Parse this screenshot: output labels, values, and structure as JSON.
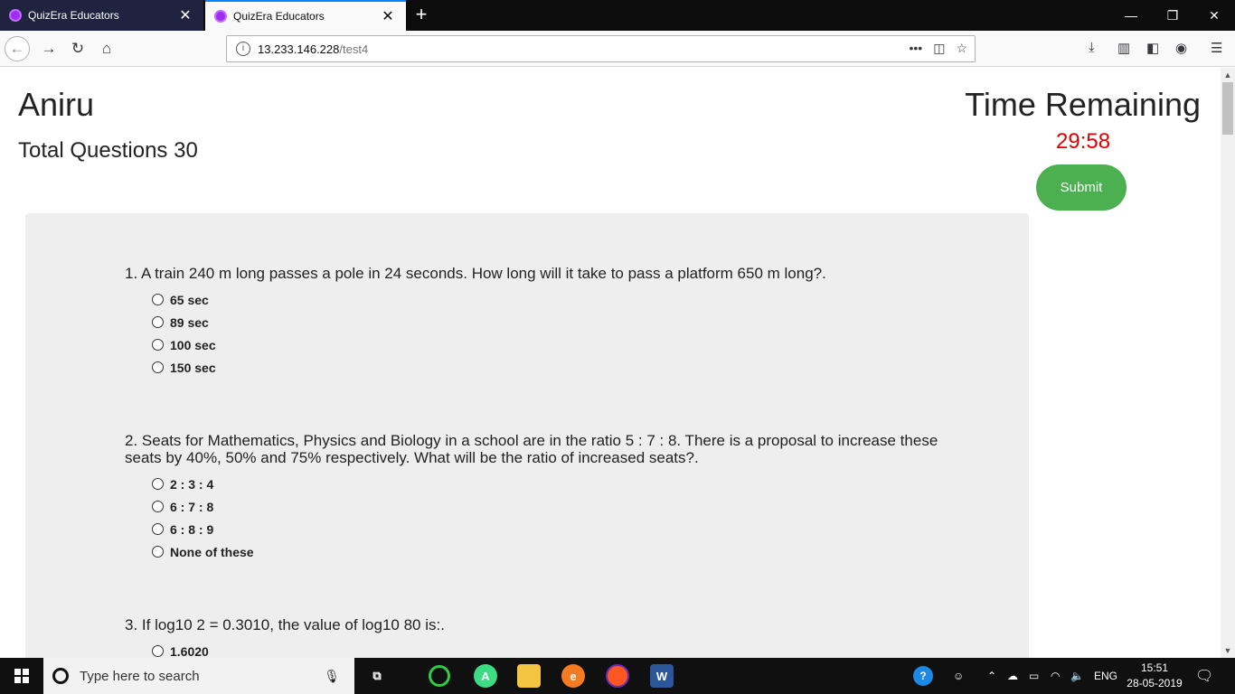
{
  "browser": {
    "tabs": [
      {
        "title": "QuizEra Educators",
        "active": false
      },
      {
        "title": "QuizEra Educators",
        "active": true
      }
    ],
    "url_host": "13.233.146.228",
    "url_path": "/test4"
  },
  "header": {
    "user_name": "Aniru",
    "total_questions": "Total Questions 30",
    "time_label": "Time Remaining",
    "timer": "29:58",
    "submit_label": "Submit"
  },
  "questions": [
    {
      "text": "1. A train 240 m long passes a pole in 24 seconds. How long will it take to pass a platform 650 m long?.",
      "options": [
        "65 sec",
        "89 sec",
        "100 sec",
        "150 sec"
      ]
    },
    {
      "text": "2. Seats for Mathematics, Physics and Biology in a school are in the ratio 5 : 7 : 8. There is a proposal to increase these seats by 40%, 50% and 75% respectively. What will be the ratio of increased seats?.",
      "options": [
        "2 : 3 : 4",
        "6 : 7 : 8",
        "6 : 8 : 9",
        "None of these"
      ]
    },
    {
      "text": "3. If log10 2 = 0.3010, the value of log10 80 is:.",
      "options": [
        "1.6020"
      ]
    }
  ],
  "taskbar": {
    "search_placeholder": "Type here to search",
    "language": "ENG",
    "time": "15:51",
    "date": "28-05-2019"
  },
  "colors": {
    "timer": "#e00000",
    "submit": "#4caf50",
    "panel": "#eeeeee"
  }
}
